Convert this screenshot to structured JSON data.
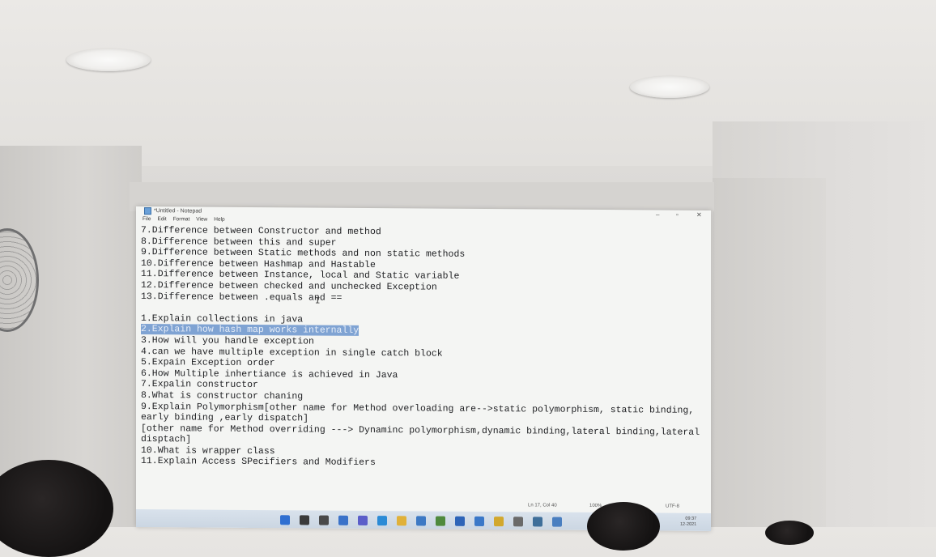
{
  "window": {
    "title": "*Untitled - Notepad",
    "controls": {
      "minimize": "–",
      "maximize": "▫",
      "close": "✕"
    }
  },
  "menu": [
    "File",
    "Edit",
    "Format",
    "View",
    "Help"
  ],
  "editor": {
    "lines": [
      "7.Difference between Constructor and method",
      "8.Difference between this and super",
      "9.Difference between Static methods and non static methods",
      "10.Difference between Hashmap and Hastable",
      "11.Difference between Instance, local and Static variable",
      "12.Difference between checked and unchecked Exception",
      "13.Difference between .equals and ==",
      "",
      "1.Explain collections in java",
      "2.Explain how hash map works internally",
      "3.How will you handle exception",
      "4.can we have multiple exception in single catch block",
      "5.Expain Exception order",
      "6.How Multiple inhertiance is achieved in Java",
      "7.Expalin constructor",
      "8.What is constructor chaning",
      "9.Explain Polymorphism[other name for Method overloading are-->static polymorphism, static binding,",
      "early binding ,early dispatch]",
      "[other name for Method overriding ---> Dynaminc polymorphism,dynamic binding,lateral binding,lateral",
      "disptach]",
      "10.What is wrapper class",
      "11.Explain Access SPecifiers and Modifiers"
    ],
    "selected_line_index": 9
  },
  "status": {
    "position": "Ln 17, Col 40",
    "zoom": "100%",
    "encoding": "UTF-8"
  },
  "taskbar": {
    "icons": [
      "windows-icon",
      "search-icon",
      "task-view-icon",
      "widgets-icon",
      "chat-icon",
      "edge-icon",
      "file-explorer-icon",
      "store-icon",
      "app-icon",
      "app-icon",
      "app-icon",
      "app-icon",
      "app-icon",
      "app-icon",
      "app-icon"
    ],
    "clock": "09:37",
    "date": "12-2021"
  },
  "colors": {
    "selection": "#7fa3d3",
    "text": "#1e1f22",
    "background": "#f4f5f3"
  }
}
